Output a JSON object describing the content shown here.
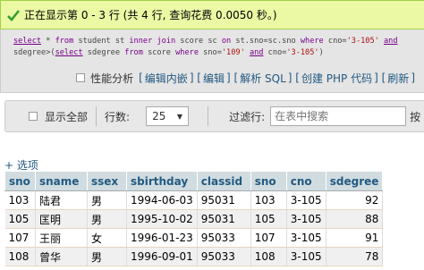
{
  "status": {
    "message": "正在显示第 0 - 3 行 (共 4 行, 查询花费 0.0050 秒。)",
    "colors": {
      "background": "#ebf8a4",
      "border": "#a2d246",
      "check": "#2e9e2e"
    }
  },
  "sql": {
    "line1": [
      {
        "t": "select",
        "c": "kw"
      },
      {
        "t": " * ",
        "c": ""
      },
      {
        "t": "from",
        "c": "kw2"
      },
      {
        "t": " student st ",
        "c": ""
      },
      {
        "t": "inner join",
        "c": "kw2"
      },
      {
        "t": " score sc ",
        "c": ""
      },
      {
        "t": "on",
        "c": "kw2"
      },
      {
        "t": " st.sno=sc.sno ",
        "c": ""
      },
      {
        "t": "where",
        "c": "kw2"
      },
      {
        "t": " cno=",
        "c": ""
      },
      {
        "t": "'3-105'",
        "c": "str"
      },
      {
        "t": " ",
        "c": ""
      },
      {
        "t": "and",
        "c": "kw"
      }
    ],
    "line2": [
      {
        "t": "sdegree>(",
        "c": ""
      },
      {
        "t": "select",
        "c": "kw"
      },
      {
        "t": " sdegree ",
        "c": ""
      },
      {
        "t": "from",
        "c": "kw2"
      },
      {
        "t": " score ",
        "c": ""
      },
      {
        "t": "where",
        "c": "kw2"
      },
      {
        "t": " sno=",
        "c": ""
      },
      {
        "t": "'109'",
        "c": "str"
      },
      {
        "t": " ",
        "c": ""
      },
      {
        "t": "and",
        "c": "kw"
      },
      {
        "t": " cno=",
        "c": ""
      },
      {
        "t": "'3-105'",
        "c": "str"
      },
      {
        "t": ")",
        "c": ""
      }
    ]
  },
  "sql_links": {
    "profile_label": "性能分析",
    "links": [
      "编辑内嵌",
      "编辑",
      "解析 SQL",
      "创建 PHP 代码",
      "刷新"
    ]
  },
  "nav": {
    "show_all": "显示全部",
    "rows_label": "行数:",
    "rows_value": "25",
    "filter_label": "过滤行:",
    "filter_placeholder": "在表中搜索",
    "sort_label": "按"
  },
  "options_link": "+ 选项",
  "table": {
    "columns": [
      "sno",
      "sname",
      "ssex",
      "sbirthday",
      "classid",
      "sno",
      "cno",
      "sdegree"
    ],
    "rows": [
      [
        "103",
        "陆君",
        "男",
        "1994-06-03",
        "95031",
        "103",
        "3-105",
        "92"
      ],
      [
        "105",
        "匡明",
        "男",
        "1995-10-02",
        "95031",
        "105",
        "3-105",
        "88"
      ],
      [
        "107",
        "王丽",
        "女",
        "1996-01-23",
        "95033",
        "107",
        "3-105",
        "91"
      ],
      [
        "108",
        "曾华",
        "男",
        "1996-09-01",
        "95033",
        "108",
        "3-105",
        "78"
      ]
    ]
  }
}
